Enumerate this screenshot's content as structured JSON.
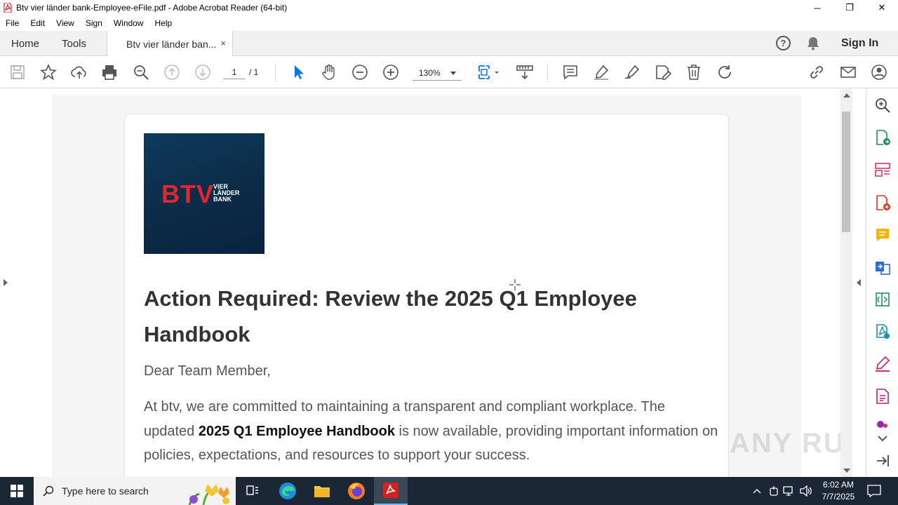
{
  "window": {
    "title": "Btv vier länder bank-Employee-eFile.pdf - Adobe Acrobat Reader (64-bit)",
    "minimize": "─",
    "maximize": "❐",
    "close": "✕"
  },
  "menu": [
    "File",
    "Edit",
    "View",
    "Sign",
    "Window",
    "Help"
  ],
  "tabs": {
    "home": "Home",
    "tools": "Tools",
    "document": "Btv vier länder ban...",
    "close": "×"
  },
  "header": {
    "help": "?",
    "sign_in": "Sign In"
  },
  "toolbar": {
    "page_current": "1",
    "page_total": "/ 1",
    "zoom": "130%"
  },
  "document": {
    "logo": {
      "mark": "BTV",
      "line1": "VIER",
      "line2": "LÄNDER",
      "line3": "BANK"
    },
    "heading": "Action Required: Review the 2025 Q1 Employee Handbook",
    "greeting": "Dear Team Member,",
    "para_part1": "At btv, we are committed to maintaining a transparent and compliant workplace. The updated ",
    "para_bold": "2025 Q1 Employee Handbook",
    "para_part2": " is now available, providing important information on policies, expectations, and resources to support your success."
  },
  "watermark": "ANY RUN",
  "taskbar": {
    "search_placeholder": "Type here to search",
    "time": "6:02 AM",
    "date": "7/7/2025"
  },
  "colors": {
    "accent": "#1473e6",
    "logo_bg": "#0b2a45",
    "logo_red": "#e3262d",
    "taskbar": "#1b2735"
  }
}
